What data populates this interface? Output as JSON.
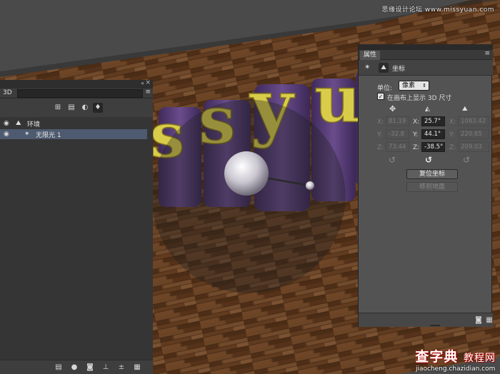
{
  "watermark": {
    "top": "思缘设计论坛 www.missyuan.com",
    "bottom_main": "查字典",
    "bottom_sub": "教程网",
    "bottom_url": "jiaocheng.chazidian.com"
  },
  "scene": {
    "text_3d": "ssyu",
    "colors": {
      "background": "#4a4a4a",
      "floor": "#5e3a20",
      "letter_side": "#5b3f7a",
      "letter_face": "#d9cc4a",
      "light_sphere": "#d8d8dc"
    }
  },
  "panel3d": {
    "title": "3D",
    "menu_icon": "panel-menu-icon",
    "filters": [
      {
        "name": "whole-scene-filter-icon",
        "glyph": "⊞"
      },
      {
        "name": "meshes-filter-icon",
        "glyph": "▤"
      },
      {
        "name": "materials-filter-icon",
        "glyph": "◐"
      },
      {
        "name": "lights-filter-icon",
        "glyph": "💡"
      }
    ],
    "items": [
      {
        "label": "环境",
        "icon": "environment-icon",
        "selected": false
      },
      {
        "label": "无限光 1",
        "icon": "infinite-light-icon",
        "selected": true
      }
    ],
    "bottom_icons": [
      "ground-plane-icon",
      "add-light-icon",
      "render-icon",
      "new-object-icon",
      "add-mesh-icon",
      "trash-icon"
    ]
  },
  "properties": {
    "tab": "属性",
    "section_title": "坐标",
    "unit_label": "单位:",
    "unit_value": "像素",
    "checkbox_label": "在画布上显示 3D 尺寸",
    "checkbox_checked": true,
    "columns": [
      {
        "icon": "move-icon",
        "state": "dim",
        "values": [
          "81.19",
          "-32.8",
          "73.44"
        ]
      },
      {
        "icon": "rotate-icon",
        "state": "active",
        "values": [
          "25.7°",
          "44.1°",
          "-38.5°"
        ]
      },
      {
        "icon": "scale-icon",
        "state": "dim",
        "values": [
          "1063.42",
          "220.65",
          "209.03"
        ]
      }
    ],
    "axes": [
      "X:",
      "Y:",
      "Z:"
    ],
    "reset_button": "复位坐标",
    "move_to_ground_button": "移到地面",
    "footer_icons": [
      "render-settings-icon",
      "delete-icon"
    ]
  }
}
